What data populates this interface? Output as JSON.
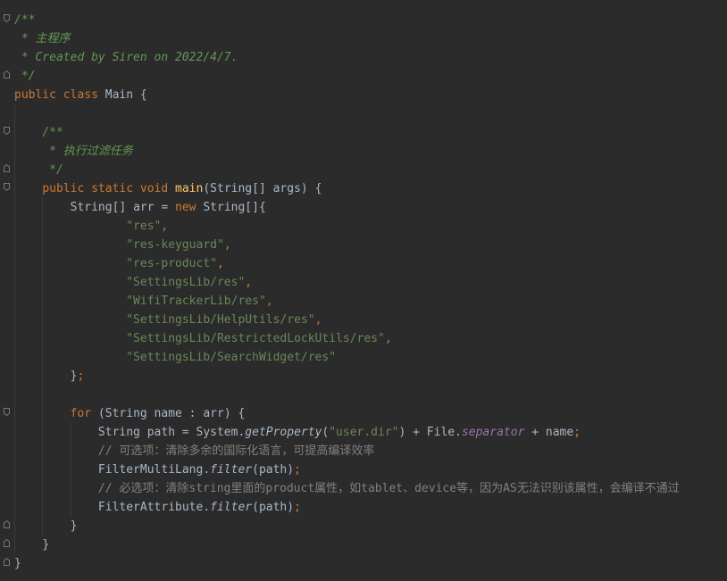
{
  "theme": {
    "background": "#2b2b2b",
    "default_text": "#a9b7c6",
    "keyword": "#cc7832",
    "string": "#6a8759",
    "doc_comment": "#629755",
    "line_comment": "#808080",
    "method_decl": "#ffc66d",
    "static_field": "#9876aa"
  },
  "code": {
    "l1": {
      "doc": "/**"
    },
    "l2": {
      "doc": " * 主程序"
    },
    "l3": {
      "doc": " * Created by Siren on 2022/4/7."
    },
    "l4": {
      "doc": " */"
    },
    "l5": {
      "kw": "public class",
      "rest": " Main {"
    },
    "l7": {
      "indent": "    ",
      "doc": "/**"
    },
    "l8": {
      "indent": "    ",
      "doc": " * 执行过滤任务"
    },
    "l9": {
      "indent": "    ",
      "doc": " */"
    },
    "l10": {
      "indent": "    ",
      "kw": "public static void",
      "sp": " ",
      "fn": "main",
      "rest": "(String[] args) {"
    },
    "l11": {
      "indent": "        ",
      "a": "String[] arr = ",
      "kw": "new",
      "b": " String[]{"
    },
    "strings": [
      {
        "indent": "                ",
        "value": "\"res\"",
        "tail": ","
      },
      {
        "indent": "                ",
        "value": "\"res-keyguard\"",
        "tail": ","
      },
      {
        "indent": "                ",
        "value": "\"res-product\"",
        "tail": ","
      },
      {
        "indent": "                ",
        "value": "\"SettingsLib/res\"",
        "tail": ","
      },
      {
        "indent": "                ",
        "value": "\"WifiTrackerLib/res\"",
        "tail": ","
      },
      {
        "indent": "                ",
        "value": "\"SettingsLib/HelpUtils/res\"",
        "tail": ","
      },
      {
        "indent": "                ",
        "value": "\"SettingsLib/RestrictedLockUtils/res\"",
        "tail": ","
      },
      {
        "indent": "                ",
        "value": "\"SettingsLib/SearchWidget/res\"",
        "tail": ""
      }
    ],
    "l20": {
      "indent": "        ",
      "a": "}",
      "semi": ";"
    },
    "l22": {
      "indent": "        ",
      "kw": "for",
      "rest": " (String name : arr) {"
    },
    "l23": {
      "indent": "            ",
      "a": "String path = System.",
      "m": "getProperty",
      "b": "(",
      "s": "\"user.dir\"",
      "c": ") + File.",
      "f": "separator",
      "d": " + name",
      "semi": ";"
    },
    "l24": {
      "indent": "            ",
      "cmt": "// 可选项：清除多余的国际化语言，可提高编译效率"
    },
    "l25": {
      "indent": "            ",
      "a": "FilterMultiLang.",
      "m": "filter",
      "b": "(path)",
      "semi": ";"
    },
    "l26": {
      "indent": "            ",
      "cmt": "// 必选项：清除string里面的product属性，如tablet、device等，因为AS无法识别该属性，会编译不通过"
    },
    "l27": {
      "indent": "            ",
      "a": "FilterAttribute.",
      "m": "filter",
      "b": "(path)",
      "semi": ";"
    },
    "l28": {
      "indent": "        ",
      "a": "}"
    },
    "l29": {
      "indent": "    ",
      "a": "}"
    },
    "l30": {
      "a": "}"
    }
  }
}
